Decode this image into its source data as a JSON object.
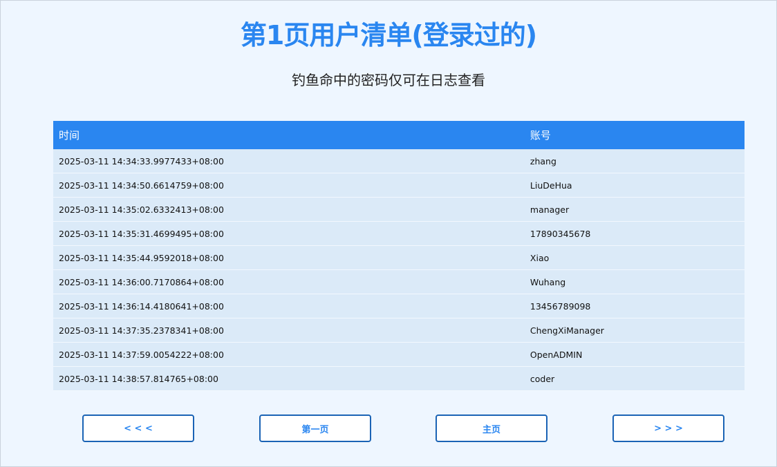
{
  "header": {
    "title": "第1页用户清单(登录过的)",
    "subtitle": "钓鱼命中的密码仅可在日志查看"
  },
  "table": {
    "columns": [
      "时间",
      "账号"
    ],
    "rows": [
      {
        "time": "2025-03-11 14:34:33.9977433+08:00",
        "account": "zhang"
      },
      {
        "time": "2025-03-11 14:34:50.6614759+08:00",
        "account": "LiuDeHua"
      },
      {
        "time": "2025-03-11 14:35:02.6332413+08:00",
        "account": "manager"
      },
      {
        "time": "2025-03-11 14:35:31.4699495+08:00",
        "account": "17890345678"
      },
      {
        "time": "2025-03-11 14:35:44.9592018+08:00",
        "account": "Xiao"
      },
      {
        "time": "2025-03-11 14:36:00.7170864+08:00",
        "account": "Wuhang"
      },
      {
        "time": "2025-03-11 14:36:14.4180641+08:00",
        "account": "13456789098"
      },
      {
        "time": "2025-03-11 14:37:35.2378341+08:00",
        "account": "ChengXiManager"
      },
      {
        "time": "2025-03-11 14:37:59.0054222+08:00",
        "account": "OpenADMIN"
      },
      {
        "time": "2025-03-11 14:38:57.814765+08:00",
        "account": "coder"
      }
    ]
  },
  "pagination": {
    "prev_label": "< < <",
    "first_label": "第一页",
    "home_label": "主页",
    "next_label": "> > >"
  },
  "colors": {
    "accent": "#2a86f0",
    "button_border": "#1a63b5",
    "page_background": "#eef6ff",
    "row_background": "#dbeaf8"
  }
}
